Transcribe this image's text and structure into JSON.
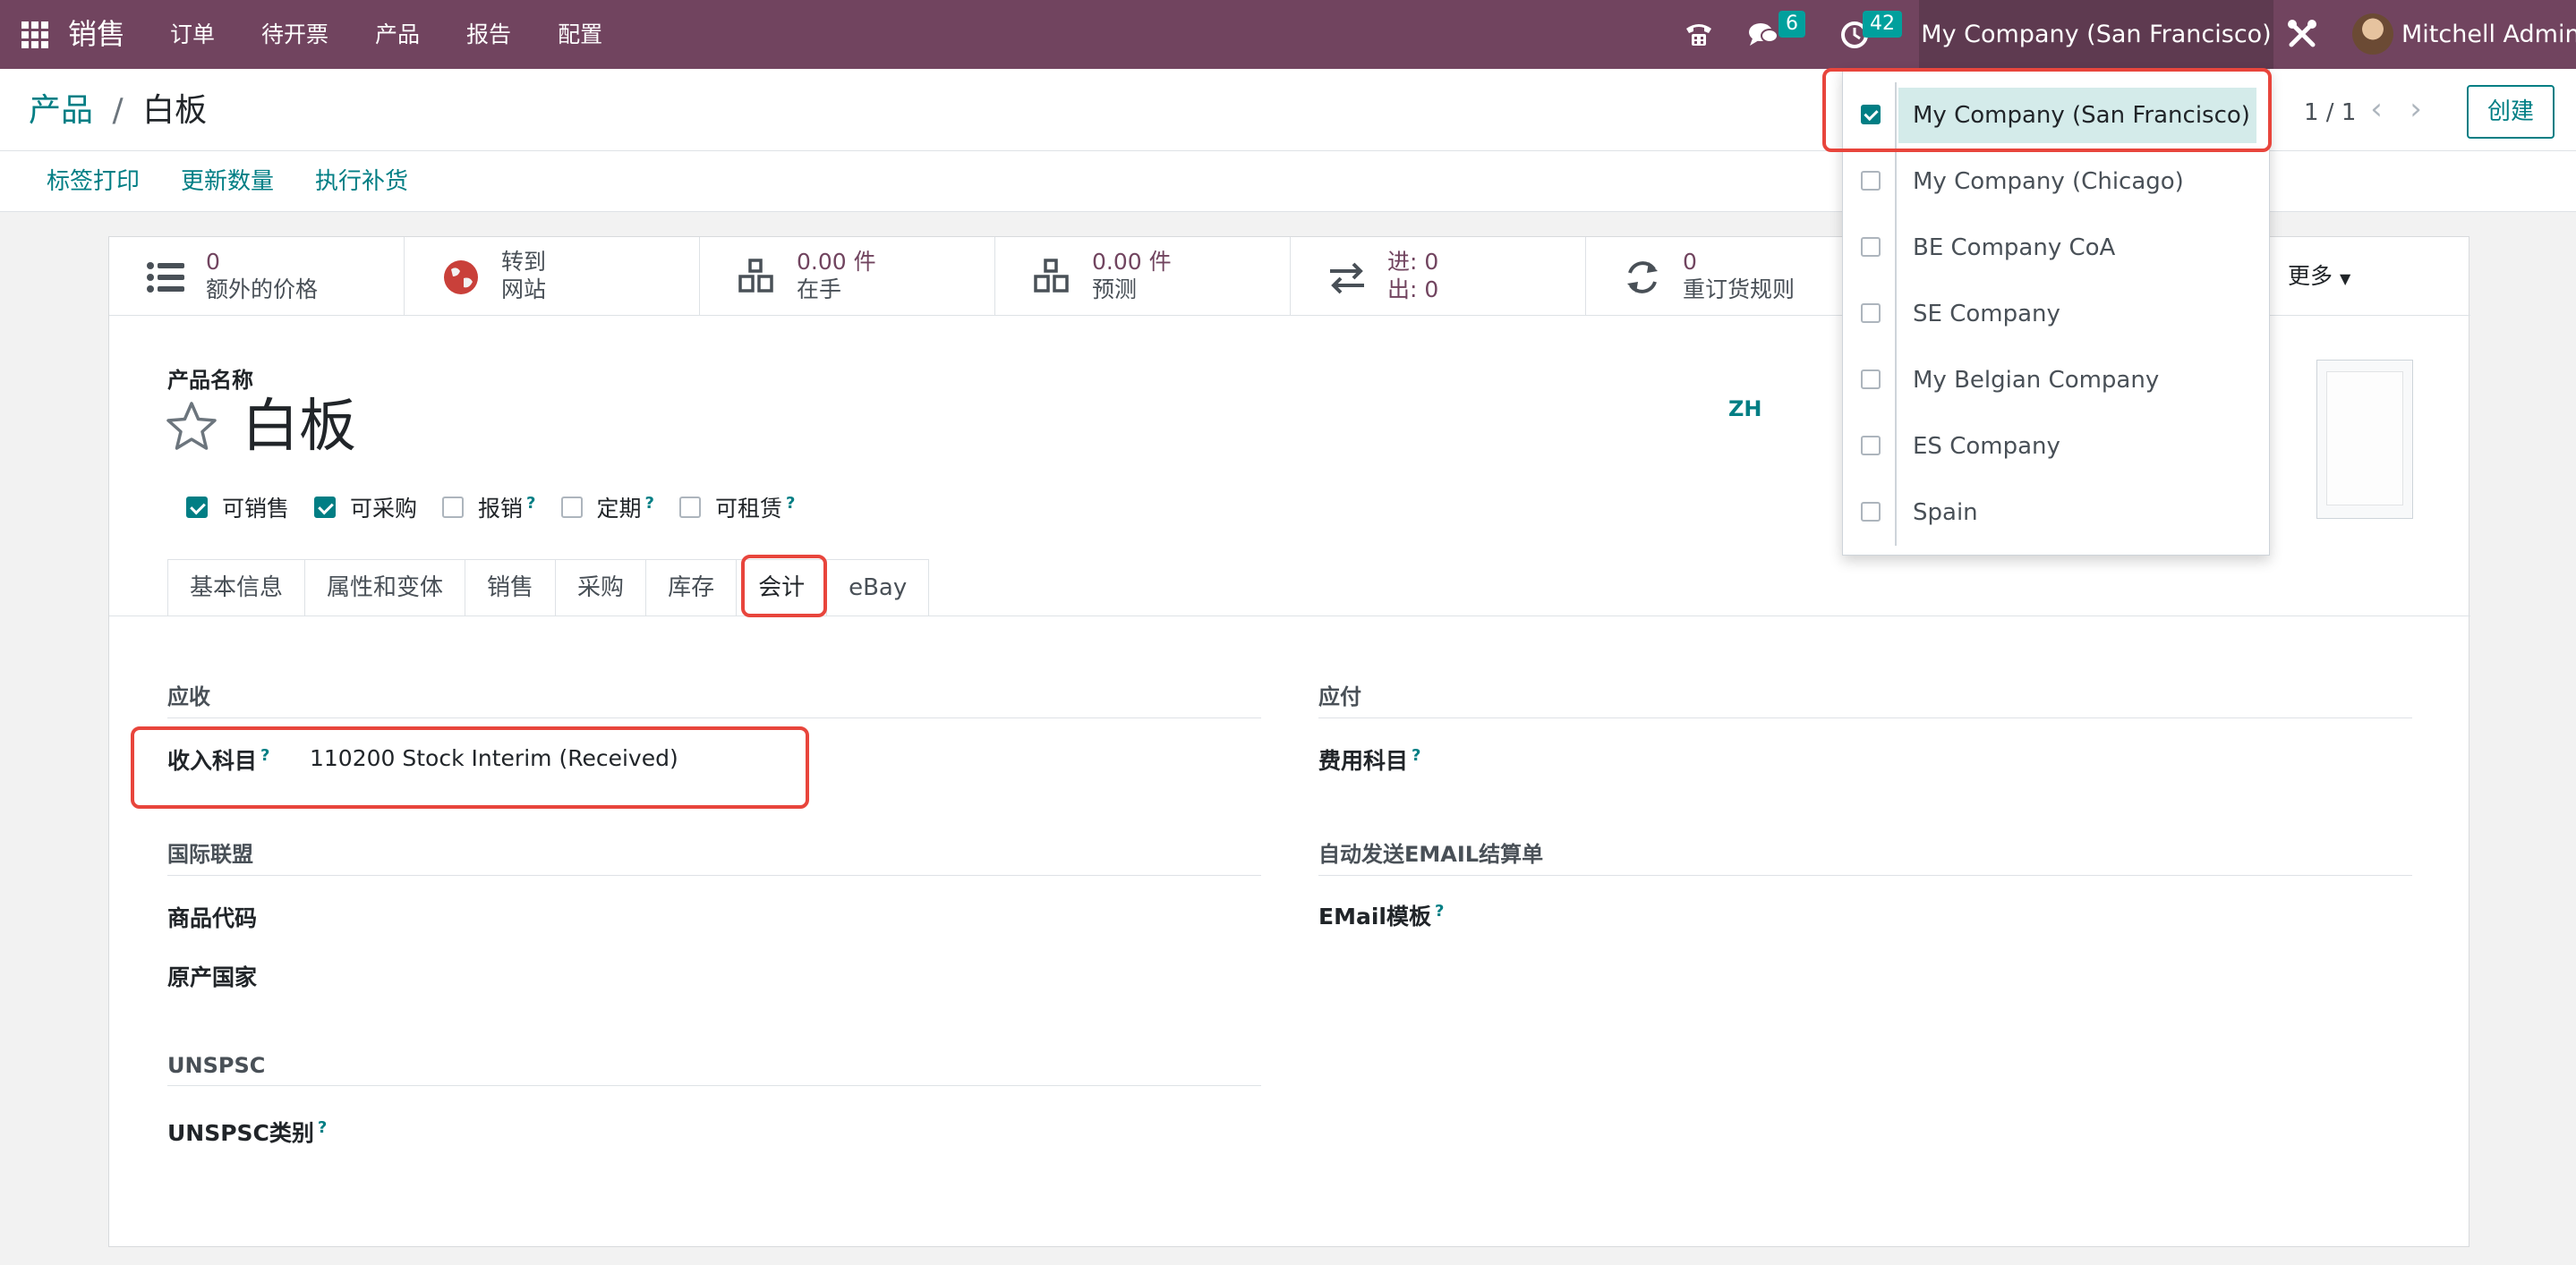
{
  "navbar": {
    "brand": "销售",
    "menu": [
      "订单",
      "待开票",
      "产品",
      "报告",
      "配置"
    ],
    "messages_count": "6",
    "activities_count": "42",
    "current_company": "My Company (San Francisco)",
    "user_name": "Mitchell Admin",
    "bg_color": "#71445f"
  },
  "control_panel": {
    "breadcrumb_parent": "产品",
    "breadcrumb_sep": "/",
    "breadcrumb_current": "白板",
    "pager": "1 / 1",
    "create_label": "创建",
    "actions": [
      "标签打印",
      "更新数量",
      "执行补货"
    ]
  },
  "stat_buttons": [
    {
      "value": "0",
      "label": "额外的价格",
      "icon": "list-icon"
    },
    {
      "value": "转到",
      "label": "网站",
      "icon": "globe-icon"
    },
    {
      "value": "0.00 件",
      "label": "在手",
      "icon": "cubes-icon"
    },
    {
      "value": "0.00 件",
      "label": "预测",
      "icon": "cubes-icon"
    },
    {
      "value": "进:  0",
      "label": "出:  0",
      "icon": "exchange-icon"
    },
    {
      "value": "0",
      "label": "重订货规则",
      "icon": "refresh-icon"
    }
  ],
  "more_label": "更多",
  "product": {
    "name_label": "产品名称",
    "name": "白板",
    "lang": "ZH",
    "options": [
      {
        "label": "可销售",
        "checked": true,
        "help": false
      },
      {
        "label": "可采购",
        "checked": true,
        "help": false
      },
      {
        "label": "报销",
        "checked": false,
        "help": true
      },
      {
        "label": "定期",
        "checked": false,
        "help": true
      },
      {
        "label": "可租赁",
        "checked": false,
        "help": true
      }
    ]
  },
  "help_mark": "?",
  "tabs": [
    "基本信息",
    "属性和变体",
    "销售",
    "采购",
    "库存",
    "会计",
    "eBay"
  ],
  "active_tab": "会计",
  "accounting": {
    "receivable_title": "应收",
    "income_account_label": "收入科目",
    "income_account_value": "110200 Stock Interim (Received)",
    "intrastat_title": "国际联盟",
    "commodity_code_label": "商品代码",
    "origin_country_label": "原产国家",
    "unspsc_title": "UNSPSC",
    "unspsc_label": "UNSPSC类别",
    "payable_title": "应付",
    "expense_account_label": "费用科目",
    "auto_email_title": "自动发送EMAIL结算单",
    "email_template_label": "EMail模板"
  },
  "company_dropdown": {
    "items": [
      {
        "name": "My Company (San Francisco)",
        "checked": true
      },
      {
        "name": "My Company (Chicago)",
        "checked": false
      },
      {
        "name": "BE Company CoA",
        "checked": false
      },
      {
        "name": "SE Company",
        "checked": false
      },
      {
        "name": "My Belgian Company",
        "checked": false
      },
      {
        "name": "ES Company",
        "checked": false
      },
      {
        "name": "Spain",
        "checked": false
      }
    ]
  },
  "colors": {
    "accent": "#017e84",
    "highlight": "#e8453c",
    "selected_bg": "#d4ebea"
  }
}
